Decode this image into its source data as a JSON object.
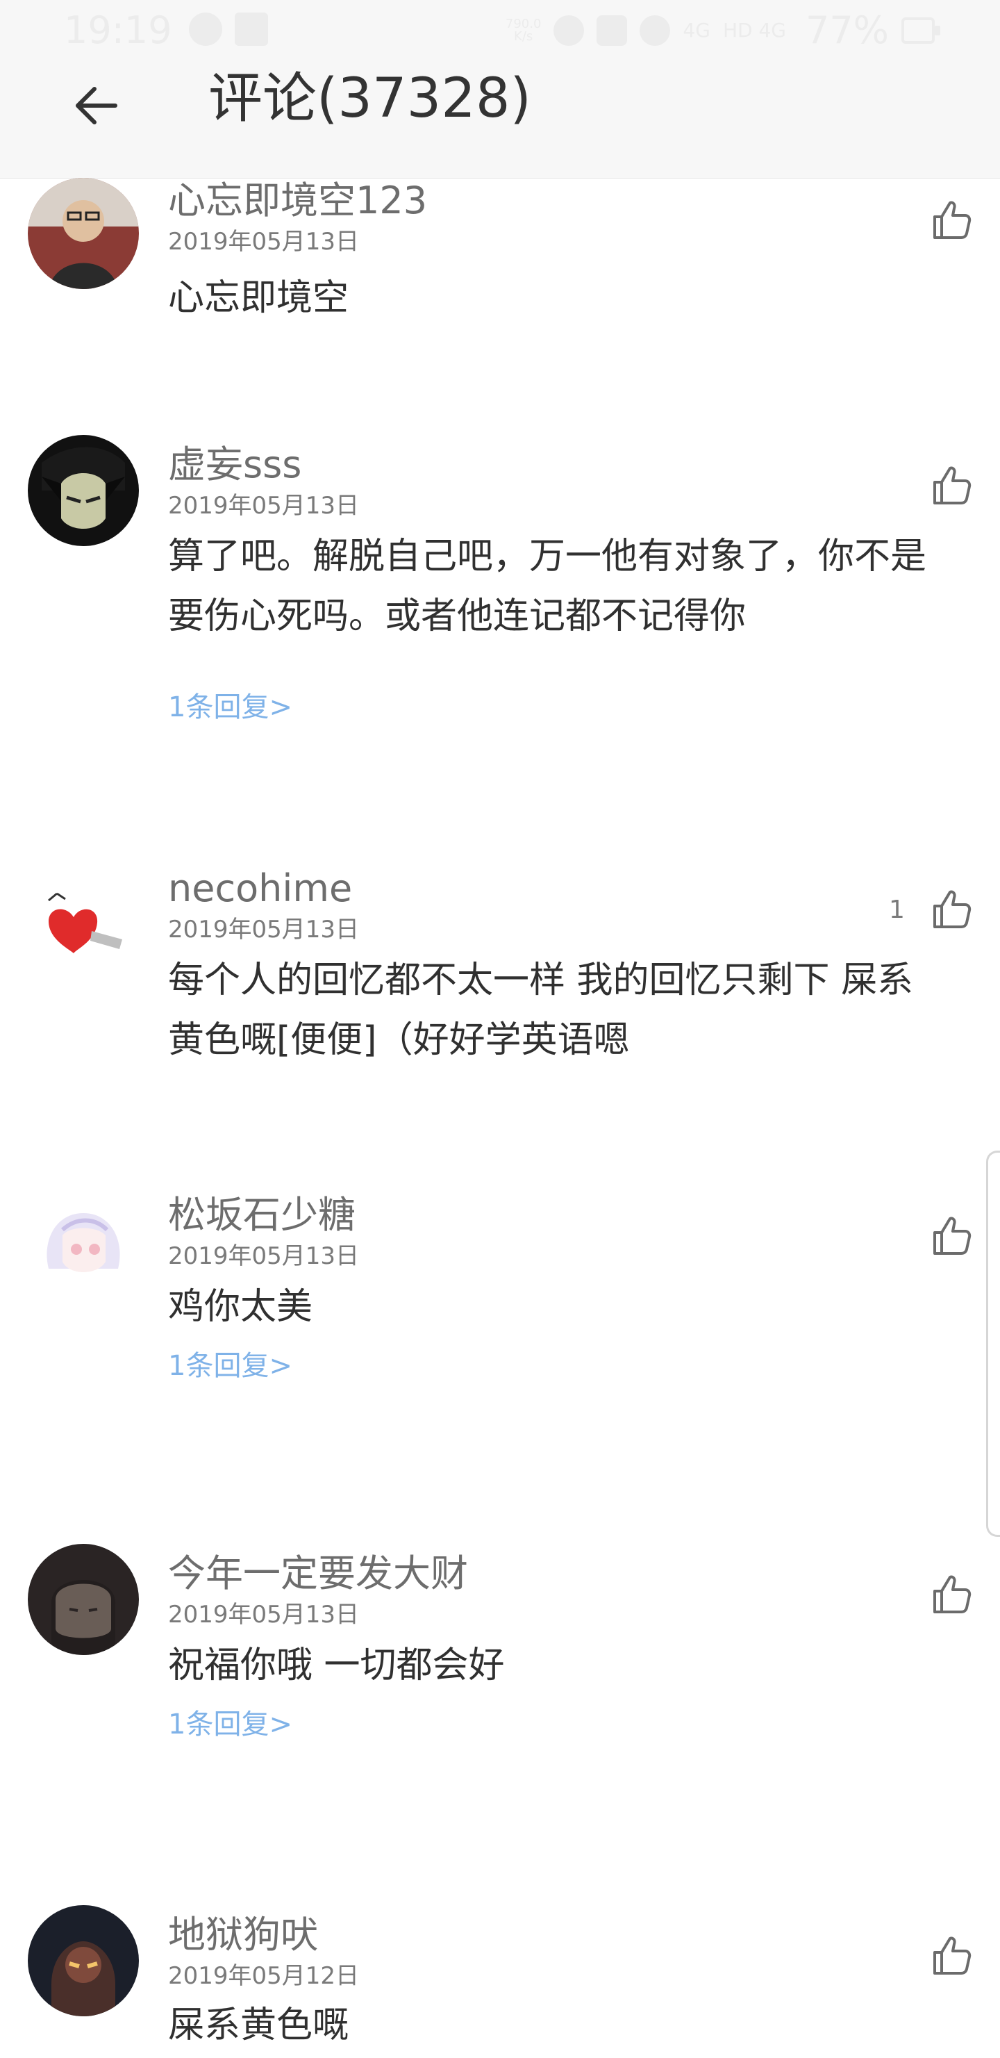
{
  "status_bar": {
    "time": "19:19",
    "net_speed_top": "790.0",
    "net_speed_bottom": "K/s",
    "signal_1": "4G",
    "signal_2": "HD 4G",
    "battery_percent": "77%"
  },
  "header": {
    "title": "评论(37328)"
  },
  "comments": [
    {
      "username": "心忘即境空123",
      "date": "2019年05月13日",
      "content": "心忘即境空",
      "reply": "",
      "likes": ""
    },
    {
      "username": "虚妄sss",
      "date": "2019年05月13日",
      "content": "算了吧。解脱自己吧，万一他有对象了，你不是要伤心死吗。或者他连记都不记得你",
      "reply": "1条回复>",
      "likes": ""
    },
    {
      "username": "necohime",
      "date": "2019年05月13日",
      "content": "每个人的回忆都不太一样 我的回忆只剩下 屎系黄色嘅[便便]（好好学英语嗯",
      "reply": "",
      "likes": "1"
    },
    {
      "username": "松坂石少糖",
      "date": "2019年05月13日",
      "content": "鸡你太美",
      "reply": "1条回复>",
      "likes": ""
    },
    {
      "username": "今年一定要发大财",
      "date": "2019年05月13日",
      "content": "祝福你哦  一切都会好",
      "reply": "1条回复>",
      "likes": ""
    },
    {
      "username": "地狱狗吠",
      "date": "2019年05月12日",
      "content": "屎系黄色嘅",
      "reply": "",
      "likes": ""
    }
  ],
  "icons": {
    "back": "arrow-left-icon",
    "like": "thumbs-up-icon"
  },
  "colors": {
    "header_bg": "#f7f7f7",
    "reply_link": "#7fb2e8",
    "username": "#6d6d6d",
    "content": "#303030",
    "date": "#7a7a7a"
  }
}
